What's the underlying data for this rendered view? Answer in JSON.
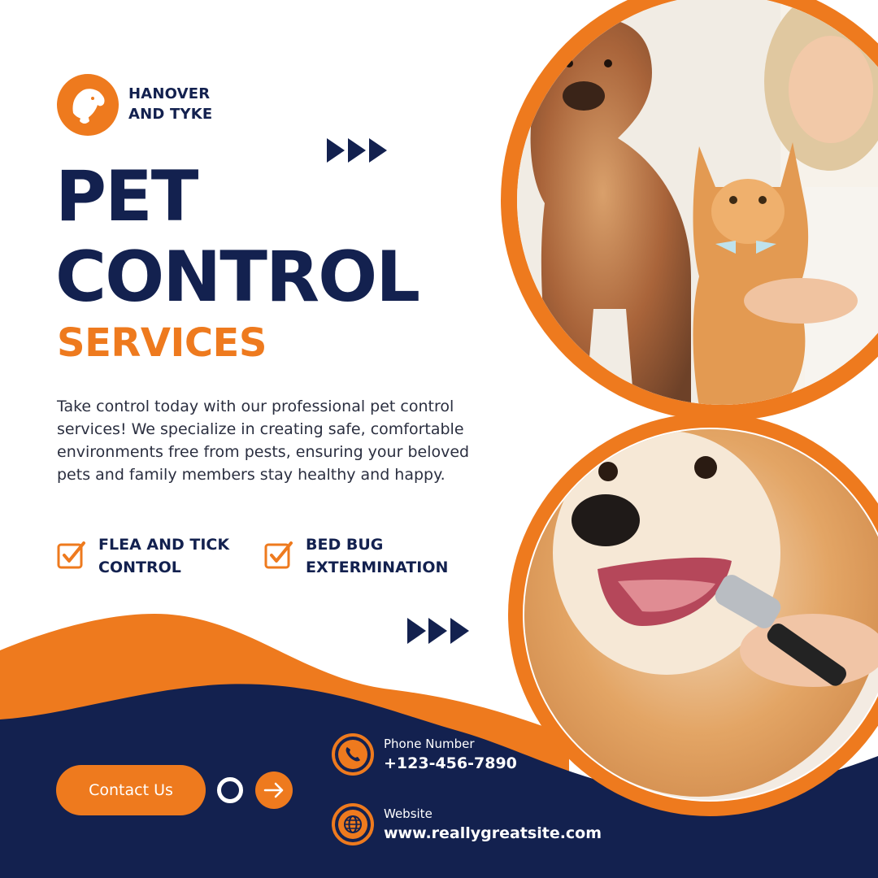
{
  "brand": {
    "line1": "HANOVER",
    "line2": "AND TYKE",
    "logo_icon": "dog-cat-logo-icon"
  },
  "headline": {
    "line1": "PET",
    "line2": "CONTROL",
    "sub": "SERVICES"
  },
  "description": "Take control today with our professional pet control services! We specialize in creating safe, comfortable environments free from pests, ensuring your beloved pets and family members stay healthy and happy.",
  "features": [
    {
      "line1": "FLEA AND TICK",
      "line2": "CONTROL",
      "icon": "checkbox-icon"
    },
    {
      "line1": "BED BUG",
      "line2": "EXTERMINATION",
      "icon": "checkbox-icon"
    }
  ],
  "cta": {
    "label": "Contact Us"
  },
  "contact": {
    "phone_label": "Phone Number",
    "phone_value": "+123-456-7890",
    "website_label": "Website",
    "website_value": "www.reallygreatsite.com"
  },
  "colors": {
    "navy": "#13214f",
    "orange": "#ee7a1e",
    "white": "#ffffff"
  }
}
